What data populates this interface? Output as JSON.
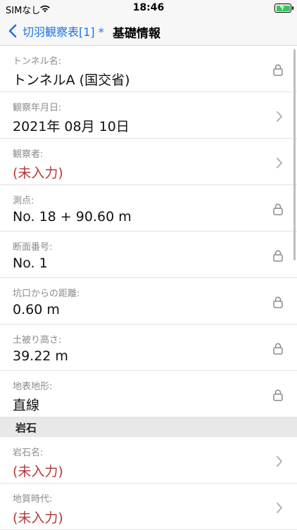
{
  "status": {
    "carrier": "SIMなし",
    "time": "18:46"
  },
  "nav": {
    "back_label": "切羽観察表[1] *",
    "title": "基礎情報"
  },
  "rows_a": [
    {
      "label": "トンネル名:",
      "value": "トンネルA (国交省)",
      "accessory": "lock",
      "empty": false
    },
    {
      "label": "観察年月日:",
      "value": "2021年 08月 10日",
      "accessory": "chevron",
      "empty": false
    },
    {
      "label": "観察者:",
      "value": "(未入力)",
      "accessory": "chevron",
      "empty": true
    },
    {
      "label": "測点:",
      "value": "No. 18 + 90.60 m",
      "accessory": "lock",
      "empty": false
    },
    {
      "label": "断面番号:",
      "value": "No. 1",
      "accessory": "lock",
      "empty": false
    },
    {
      "label": "坑口からの距離:",
      "value": "0.60 m",
      "accessory": "lock",
      "empty": false
    },
    {
      "label": "土被り高さ:",
      "value": "39.22 m",
      "accessory": "lock",
      "empty": false
    },
    {
      "label": "地表地形:",
      "value": "直線",
      "accessory": "lock",
      "empty": false
    }
  ],
  "section_title": "岩石",
  "rows_b": [
    {
      "label": "岩石名:",
      "value": "(未入力)",
      "accessory": "chevron",
      "empty": true
    },
    {
      "label": "地質時代:",
      "value": "(未入力)",
      "accessory": "chevron",
      "empty": true
    }
  ],
  "colors": {
    "accent": "#1a73e8",
    "empty_value": "#b33a3a",
    "battery": "#34c759"
  }
}
